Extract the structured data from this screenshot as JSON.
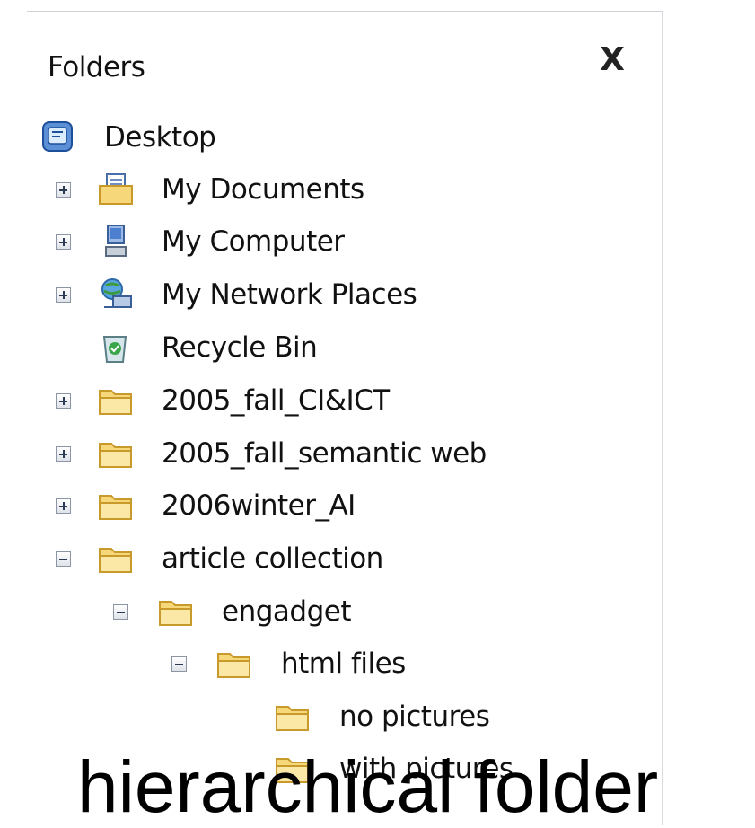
{
  "panel": {
    "title": "Folders",
    "close_label": "X"
  },
  "tree": [
    {
      "label": "Desktop",
      "icon": "desktop-icon",
      "expander": "none"
    },
    {
      "label": "My Documents",
      "icon": "my-documents-icon",
      "expander": "plus"
    },
    {
      "label": "My Computer",
      "icon": "my-computer-icon",
      "expander": "plus"
    },
    {
      "label": "My Network Places",
      "icon": "network-places-icon",
      "expander": "plus"
    },
    {
      "label": "Recycle Bin",
      "icon": "recycle-bin-icon",
      "expander": "none"
    },
    {
      "label": "2005_fall_CI&ICT",
      "icon": "folder-icon",
      "expander": "plus"
    },
    {
      "label": "2005_fall_semantic web",
      "icon": "folder-icon",
      "expander": "plus"
    },
    {
      "label": "2006winter_AI",
      "icon": "folder-icon",
      "expander": "plus"
    },
    {
      "label": "article collection",
      "icon": "folder-icon",
      "expander": "minus"
    },
    {
      "label": "engadget",
      "icon": "folder-icon",
      "expander": "minus"
    },
    {
      "label": "html files",
      "icon": "folder-icon",
      "expander": "minus"
    },
    {
      "label": "no pictures",
      "icon": "folder-icon",
      "expander": "none"
    },
    {
      "label": "with pictures",
      "icon": "folder-icon",
      "expander": "none"
    }
  ],
  "caption": "hierarchical folder",
  "colors": {
    "folder_fill": "#f6d77a",
    "folder_stroke": "#c89a2c",
    "expander_border": "#8b95a4"
  }
}
